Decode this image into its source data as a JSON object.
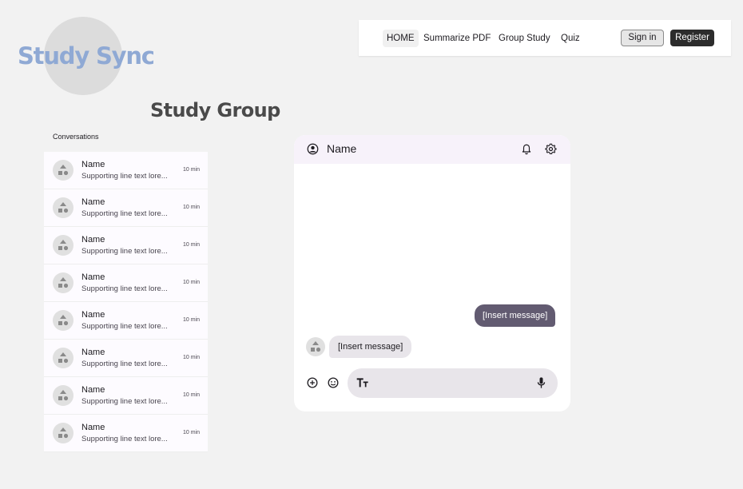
{
  "brand": {
    "logo_text": "Study Sync",
    "color": "#8fa9d4"
  },
  "nav": {
    "items": [
      "HOME",
      "Summarize PDF",
      "Group Study",
      "Quiz"
    ],
    "signin_label": "Sign in",
    "register_label": "Register"
  },
  "page": {
    "title": "Study Group"
  },
  "conversations": {
    "header": "Conversations",
    "items": [
      {
        "name": "Name",
        "preview": "Supporting line text lore...",
        "time": "10 min"
      },
      {
        "name": "Name",
        "preview": "Supporting line text lore...",
        "time": "10 min"
      },
      {
        "name": "Name",
        "preview": "Supporting line text lore...",
        "time": "10 min"
      },
      {
        "name": "Name",
        "preview": "Supporting line text lore...",
        "time": "10 min"
      },
      {
        "name": "Name",
        "preview": "Supporting line text lore...",
        "time": "10 min"
      },
      {
        "name": "Name",
        "preview": "Supporting line text lore...",
        "time": "10 min"
      },
      {
        "name": "Name",
        "preview": "Supporting line text lore...",
        "time": "10 min"
      },
      {
        "name": "Name",
        "preview": "Supporting line text lore...",
        "time": "10 min"
      }
    ]
  },
  "chat": {
    "contact_name": "Name",
    "outgoing_message": "[Insert message]",
    "incoming_message": "[Insert message]",
    "icons": [
      "account-circle-icon",
      "bell-icon",
      "gear-icon",
      "add-circle-icon",
      "emoji-icon",
      "text-format-icon",
      "mic-icon"
    ],
    "accent_color": "#625b71"
  }
}
